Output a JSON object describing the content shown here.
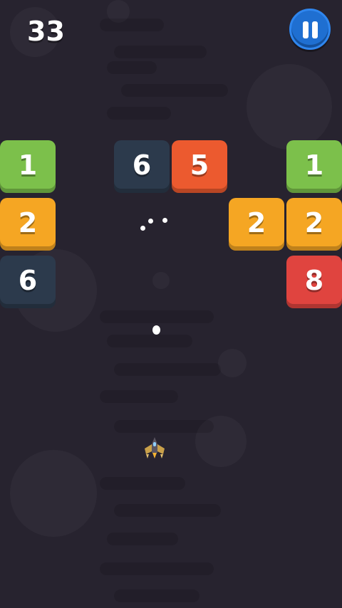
{
  "hud": {
    "score": "33",
    "pause_icon": "pause-icon"
  },
  "colors": {
    "background": "#27232f",
    "green": "#7cc04b",
    "orange": "#f5a623",
    "red_orange": "#ec5a2f",
    "red": "#e0443f",
    "dark": "#2c3a4c",
    "pause_blue": "#1f6fd1"
  },
  "blocks": [
    {
      "value": "1",
      "color": "green"
    },
    {
      "value": "6",
      "color": "dark"
    },
    {
      "value": "5",
      "color": "red_orange"
    },
    {
      "value": "1",
      "color": "green"
    },
    {
      "value": "2",
      "color": "orange"
    },
    {
      "value": "2",
      "color": "orange"
    },
    {
      "value": "2",
      "color": "orange"
    },
    {
      "value": "6",
      "color": "dark"
    },
    {
      "value": "8",
      "color": "red"
    }
  ],
  "player": {
    "icon": "spaceship-icon"
  }
}
